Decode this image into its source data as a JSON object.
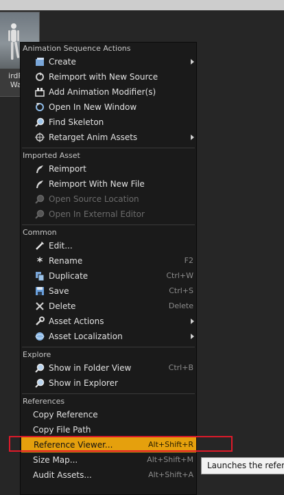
{
  "thumbnail": {
    "name_line1": "irdPer",
    "name_line2": "Walk"
  },
  "menu": {
    "sections": {
      "anim": "Animation Sequence Actions",
      "imported": "Imported Asset",
      "common": "Common",
      "explore": "Explore",
      "references": "References"
    },
    "anim_items": {
      "create": "Create",
      "reimport_new_source": "Reimport with New Source",
      "add_modifier": "Add Animation Modifier(s)",
      "open_new_window": "Open In New Window",
      "find_skeleton": "Find Skeleton",
      "retarget": "Retarget Anim Assets"
    },
    "imported_items": {
      "reimport": "Reimport",
      "reimport_new_file": "Reimport With New File",
      "open_source_location": "Open Source Location",
      "open_external_editor": "Open In External Editor"
    },
    "common_items": {
      "edit": "Edit...",
      "rename": "Rename",
      "rename_sc": "F2",
      "duplicate": "Duplicate",
      "duplicate_sc": "Ctrl+W",
      "save": "Save",
      "save_sc": "Ctrl+S",
      "delete": "Delete",
      "delete_sc": "Delete",
      "asset_actions": "Asset Actions",
      "asset_localization": "Asset Localization"
    },
    "explore_items": {
      "show_folder": "Show in Folder View",
      "show_folder_sc": "Ctrl+B",
      "show_explorer": "Show in Explorer"
    },
    "ref_items": {
      "copy_reference": "Copy Reference",
      "copy_file_path": "Copy File Path",
      "reference_viewer": "Reference Viewer...",
      "reference_viewer_sc": "Alt+Shift+R",
      "size_map": "Size Map...",
      "size_map_sc": "Alt+Shift+M",
      "audit_assets": "Audit Assets...",
      "audit_assets_sc": "Alt+Shift+A"
    }
  },
  "tooltip": {
    "text": "Launches the referen"
  },
  "colors": {
    "highlight": "#e5a00d",
    "focus_ring": "#e01a2a",
    "menu_bg": "#1a1a1a"
  }
}
